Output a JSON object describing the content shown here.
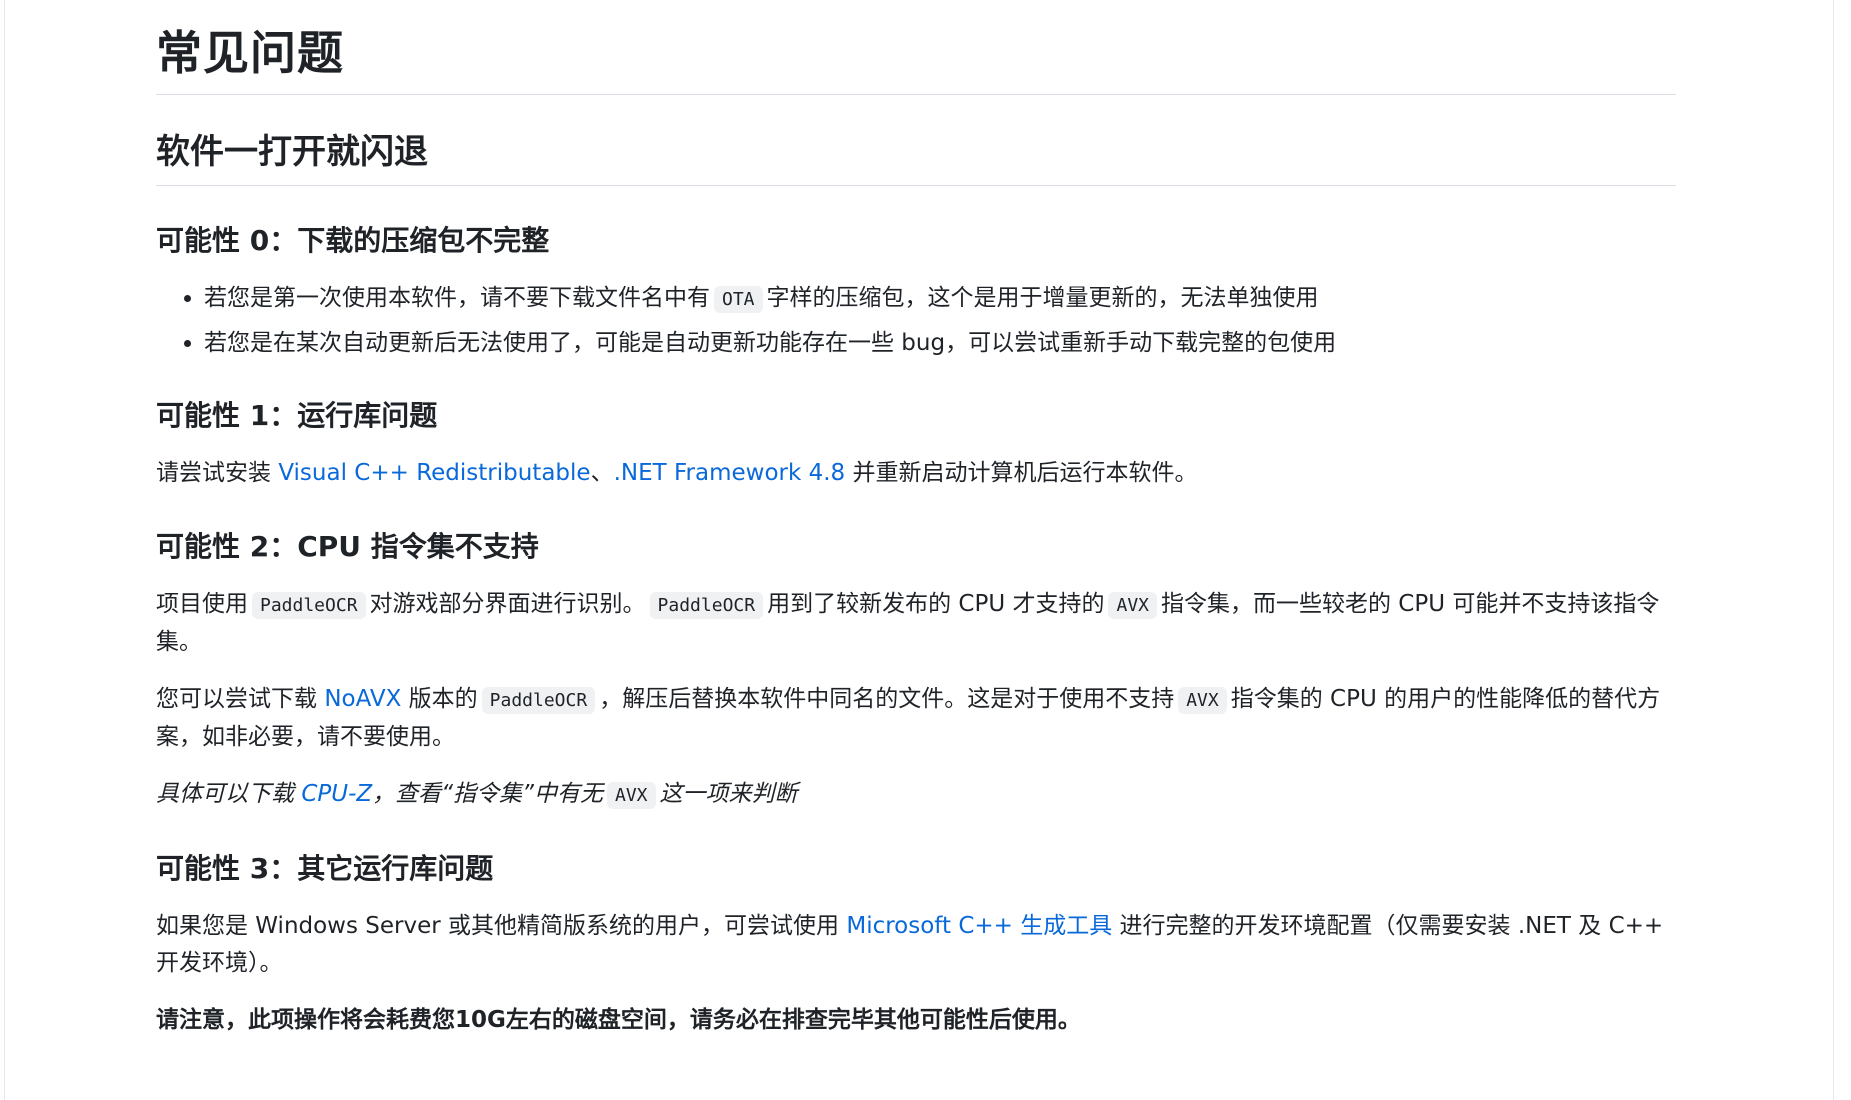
{
  "title": "常见问题",
  "section": {
    "title": "软件一打开就闪退"
  },
  "p0": {
    "title": "可能性 0：下载的压缩包不完整",
    "b1_pre": "若您是第一次使用本软件，请不要下载文件名中有",
    "b1_code": "OTA",
    "b1_post": "字样的压缩包，这个是用于增量更新的，无法单独使用",
    "b2": "若您是在某次自动更新后无法使用了，可能是自动更新功能存在一些 bug，可以尝试重新手动下载完整的包使用"
  },
  "p1": {
    "title": "可能性 1：运行库问题",
    "pre": "请尝试安装 ",
    "link1": "Visual C++ Redistributable",
    "sep": "、",
    "link2": ".NET Framework 4.8",
    "post": " 并重新启动计算机后运行本软件。"
  },
  "p2": {
    "title": "可能性 2：CPU 指令集不支持",
    "a_pre": "项目使用",
    "a_code1": "PaddleOCR",
    "a_mid1": "对游戏部分界面进行识别。",
    "a_code2": "PaddleOCR",
    "a_mid2": "用到了较新发布的 CPU 才支持的",
    "a_code3": "AVX",
    "a_post": "指令集，而一些较老的 CPU 可能并不支持该指令集。",
    "b_pre": "您可以尝试下载 ",
    "b_link": "NoAVX",
    "b_mid1": " 版本的",
    "b_code1": "PaddleOCR",
    "b_mid2": "，解压后替换本软件中同名的文件。这是对于使用不支持",
    "b_code2": "AVX",
    "b_post": "指令集的 CPU 的用户的性能降低的替代方案，如非必要，请不要使用。",
    "c_pre": "具体可以下载 ",
    "c_link": "CPU-Z",
    "c_mid": "，查看“指令集”中有无",
    "c_code": "AVX",
    "c_post": "这一项来判断"
  },
  "p3": {
    "title": "可能性 3：其它运行库问题",
    "a_pre": "如果您是 Windows Server 或其他精简版系统的用户，可尝试使用 ",
    "a_link": "Microsoft C++ 生成工具",
    "a_post": " 进行完整的开发环境配置（仅需要安装 .NET 及 C++ 开发环境）。",
    "warning": "请注意，此项操作将会耗费您10G左右的磁盘空间，请务必在排查完毕其他可能性后使用。"
  },
  "colors": {
    "link": "#0969da",
    "text": "#1f2328",
    "code_bg": "#eff1f3",
    "divider": "#d8dee4"
  }
}
